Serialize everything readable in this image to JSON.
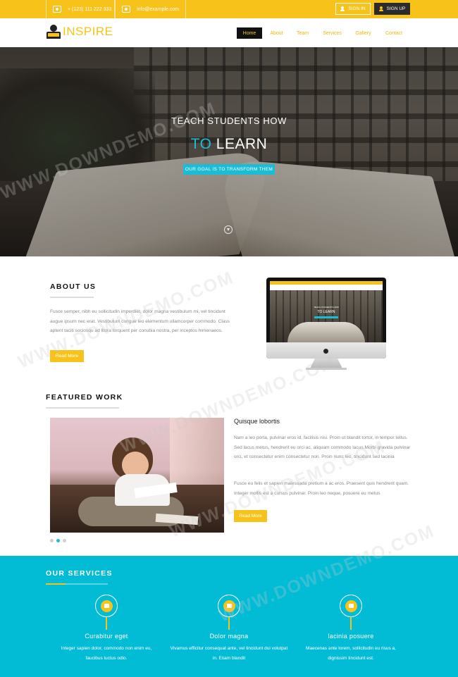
{
  "topbar": {
    "phone": "+ (123) 111 222 333",
    "email": "info@example.com",
    "signin_label": "SIGN IN",
    "signup_label": "SIGN UP",
    "bg_color": "#f7c31a"
  },
  "nav": {
    "logo_text": "INSPIRE",
    "items": [
      "Home",
      "About",
      "Team",
      "Services",
      "Gallery",
      "Contact"
    ],
    "active": "Home"
  },
  "hero": {
    "line1": "TEACH STUDENTS HOW",
    "line2_accent": "TO",
    "line2_rest": "LEARN",
    "badge": "OUR GOAL IS TO TRANSFORM THEM",
    "accent_color": "#1bbcd6"
  },
  "about": {
    "heading": "ABOUT US",
    "body": "Fusce semper, nibh eu sollicitudin imperdiet, dolor magna vestibulum mi, vel tincidunt augue ipsum nec erat. Vestibulum congue leo elementum ullamcorper commodo. Class aptent taciti sociosqu ad litora torquent per conubia nostra, per inceptos himenaeos.",
    "button": "Read More",
    "mockup": {
      "line1": "TEACH STUDENTS HOW",
      "line2": "TO LEARN"
    }
  },
  "featured": {
    "heading": "FEATURED WORK",
    "title": "Quisque lobortis",
    "para1": "Nam a leo porta, pulvinar eros id, facilisis nisi. Proin ut blandit tortor, in tempor tellus. Sed lacus metus, hendrerit eu orci ac, aliquam commodo lacus.Morbi gravida pulvinar orci, et consectetur enim consectetur non. Proin nunc leo, tincidunt sed lacinia",
    "para2": "Fusce eu felis et sapien malesuada pretium a ac eros. Praesent quis hendrerit quam. Integer mollis est a cursus pulvinar. Proin leo neque, posuere eu metus",
    "button": "Read More",
    "slides": 3,
    "active_slide": 2
  },
  "services": {
    "heading": "OUR SERVICES",
    "bg_color": "#02bcd6",
    "items": [
      {
        "icon": "graduation-cap-icon",
        "title": "Curabitur eget",
        "text": "Integer sapien dolor, commodo non enim eu, faucibus luctus odio."
      },
      {
        "icon": "briefcase-icon",
        "title": "Dolor magna",
        "text": "Vivamus efficitur consequat ante, vel tincidunt dui volutpat in. Etiam blandit"
      },
      {
        "icon": "book-icon",
        "title": "lacinia posuere",
        "text": "Maecenas ante lorem, sollicitudin eu risus a, dignissim tincidunt est."
      }
    ]
  },
  "watermark": "WWW.DOWNDEMO.COM"
}
